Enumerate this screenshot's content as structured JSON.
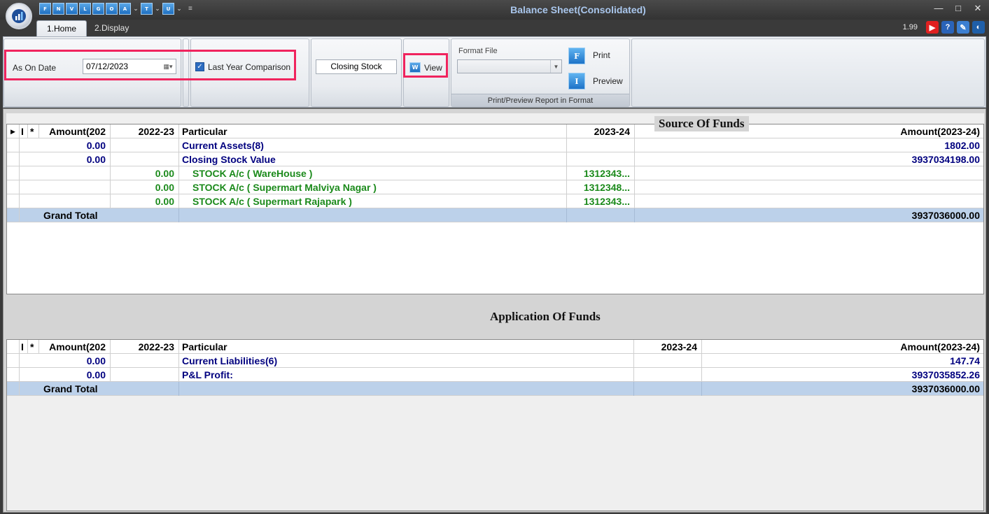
{
  "window": {
    "title": "Balance Sheet(Consolidated)",
    "quick_access": [
      "F",
      "N",
      "V",
      "L",
      "G",
      "O",
      "A",
      "T",
      "U"
    ],
    "version": "1.99"
  },
  "tabs": [
    {
      "label": "1.Home"
    },
    {
      "label": "2.Display"
    }
  ],
  "ribbon": {
    "as_on_date_label": "As On Date",
    "as_on_date_value": "07/12/2023",
    "last_year_comparison_label": "Last Year Comparison",
    "closing_stock_label": "Closing Stock",
    "view_label": "View",
    "format_file_label": "Format File",
    "format_file_value": "",
    "print_label": "Print",
    "preview_label": "Preview",
    "print_group_label": "Print/Preview Report in Format"
  },
  "source_of_funds": {
    "title": "Source Of Funds",
    "headers": {
      "sel": "I",
      "star": "*",
      "amount_prev": "Amount(202",
      "prev_year": "2022-23",
      "particular": "Particular",
      "cur_year": "2023-24",
      "amount_cur": "Amount(2023-24)"
    },
    "rows": [
      {
        "amount_prev": "0.00",
        "prev_year": "",
        "particular": "Current Assets(8)",
        "cur_year": "",
        "amount_cur": "1802.00",
        "style": "navy"
      },
      {
        "amount_prev": "0.00",
        "prev_year": "",
        "particular": "Closing Stock Value",
        "cur_year": "",
        "amount_cur": "3937034198.00",
        "style": "navy"
      },
      {
        "amount_prev": "",
        "prev_year": "0.00",
        "particular": "STOCK A/c (  WareHouse )",
        "cur_year": "1312343...",
        "amount_cur": "",
        "style": "green"
      },
      {
        "amount_prev": "",
        "prev_year": "0.00",
        "particular": "STOCK A/c ( Supermart Malviya Nagar )",
        "cur_year": "1312348...",
        "amount_cur": "",
        "style": "green"
      },
      {
        "amount_prev": "",
        "prev_year": "0.00",
        "particular": "STOCK A/c ( Supermart Rajapark )",
        "cur_year": "1312343...",
        "amount_cur": "",
        "style": "green"
      }
    ],
    "total": {
      "label": "Grand Total",
      "amount_cur": "3937036000.00"
    }
  },
  "application_of_funds": {
    "title": "Application Of Funds",
    "headers": {
      "sel": "I",
      "star": "*",
      "amount_prev": "Amount(202",
      "prev_year": "2022-23",
      "particular": "Particular",
      "cur_year": "2023-24",
      "amount_cur": "Amount(2023-24)"
    },
    "rows": [
      {
        "amount_prev": "0.00",
        "prev_year": "",
        "particular": "Current Liabilities(6)",
        "cur_year": "",
        "amount_cur": "147.74",
        "style": "navy"
      },
      {
        "amount_prev": "0.00",
        "prev_year": "",
        "particular": "P&L Profit:",
        "cur_year": "",
        "amount_cur": "3937035852.26",
        "style": "navy"
      }
    ],
    "total": {
      "label": "Grand Total",
      "amount_cur": "3937036000.00"
    }
  }
}
